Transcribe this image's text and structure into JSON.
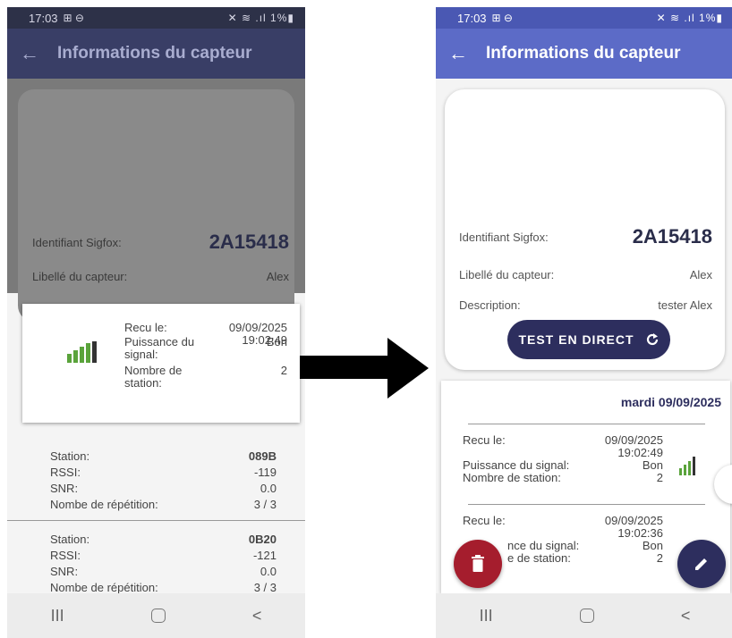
{
  "status_bar": {
    "time": "17:03",
    "left_icons": "⊞ ⊖",
    "right_icons": "✕ ≋ .ıl 1%▮"
  },
  "app_bar": {
    "back_icon": "arrow-left-icon",
    "title": "Informations du capteur"
  },
  "left_screen": {
    "sigfox_label": "Identifiant Sigfox:",
    "sigfox_id": "2A15418",
    "sensor_label": "Libellé du capteur:",
    "sensor_value": "Alex",
    "popup": {
      "signal_icon": "signal-strength-icon",
      "received_label": "Recu le:",
      "received_value_date": "09/09/2025",
      "received_value_time": "19:02:49",
      "signal_label": "Puissance du signal:",
      "signal_value": "Bon",
      "stations_label": "Nombre de station:",
      "stations_value": "2"
    },
    "stations": [
      {
        "station_label": "Station:",
        "station": "089B",
        "rssi_label": "RSSI:",
        "rssi": "-119",
        "snr_label": "SNR:",
        "snr": "0.0",
        "rep_label": "Nombe de répétition:",
        "rep": "3 / 3"
      },
      {
        "station_label": "Station:",
        "station": "0B20",
        "rssi_label": "RSSI:",
        "rssi": "-121",
        "snr_label": "SNR:",
        "snr": "0.0",
        "rep_label": "Nombe de répétition:",
        "rep": "3 / 3"
      }
    ]
  },
  "right_screen": {
    "sigfox_label": "Identifiant Sigfox:",
    "sigfox_id": "2A15418",
    "sensor_label": "Libellé du capteur:",
    "sensor_value": "Alex",
    "description_label": "Description:",
    "description_value": "tester Alex",
    "test_button": "TEST EN DIRECT",
    "history_date": "mardi 09/09/2025",
    "entries": [
      {
        "received_label": "Recu le:",
        "date": "09/09/2025",
        "time": "19:02:49",
        "signal_label": "Puissance du signal:",
        "signal": "Bon",
        "stations_label": "Nombre de station:",
        "stations": "2"
      },
      {
        "received_label": "Recu le:",
        "date": "09/09/2025",
        "time": "19:02:36",
        "signal_label": "nce du signal:",
        "signal": "Bon",
        "stations_label": "e de station:",
        "stations": "2"
      }
    ]
  },
  "nav_bar": {
    "recents": "III",
    "back": "<"
  },
  "colors": {
    "primary": "#5c6bc7",
    "dark_navy": "#2d2e5e",
    "delete_red": "#a51d2d",
    "signal_green": "#5aa33b"
  }
}
